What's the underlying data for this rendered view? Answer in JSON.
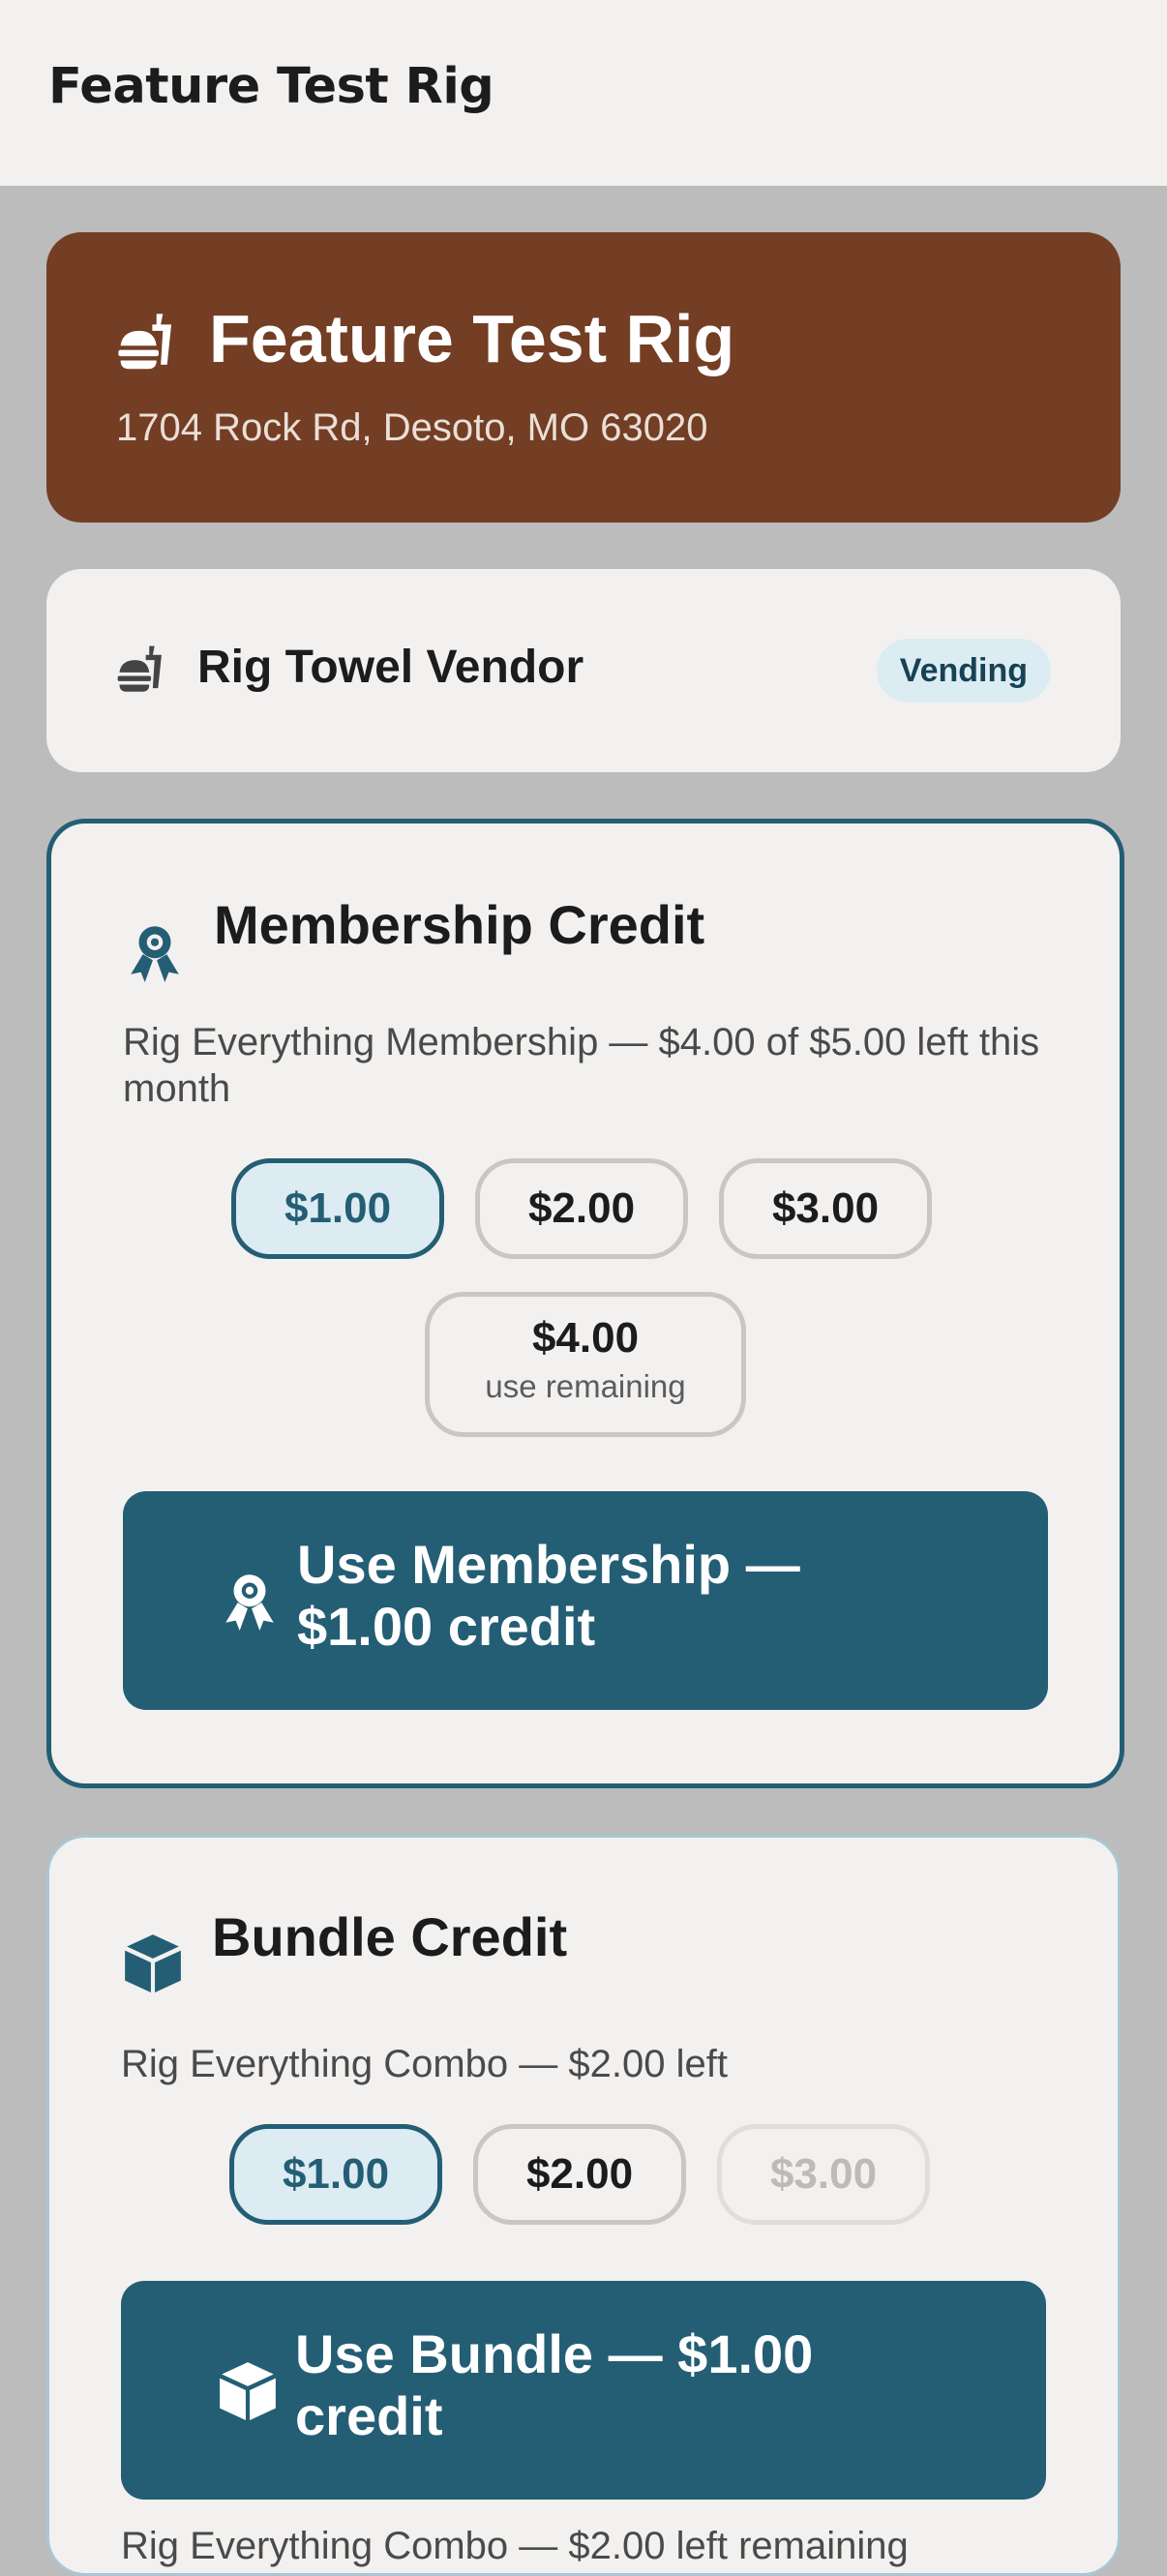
{
  "topbar": {
    "title": "Feature Test Rig"
  },
  "hero": {
    "icon": "fastfood-icon",
    "title": "Feature Test Rig",
    "address": "1704 Rock Rd, Desoto, MO 63020"
  },
  "vendor": {
    "icon": "fastfood-icon",
    "name": "Rig Towel Vendor",
    "badge": "Vending"
  },
  "membership": {
    "icon": "award-icon",
    "title": "Membership Credit",
    "description": "Rig Everything Membership — $4.00 of $5.00 left this month",
    "amounts": [
      {
        "label": "$1.00",
        "state": "selected"
      },
      {
        "label": "$2.00",
        "state": "default"
      },
      {
        "label": "$3.00",
        "state": "default"
      },
      {
        "label": "$4.00",
        "sub": "use remaining",
        "state": "default"
      }
    ],
    "button_label": "Use Membership — $1.00 credit"
  },
  "bundle": {
    "icon": "cube-icon",
    "title": "Bundle Credit",
    "description": "Rig Everything Combo — $2.00 left",
    "amounts": [
      {
        "label": "$1.00",
        "state": "selected"
      },
      {
        "label": "$2.00",
        "state": "default"
      },
      {
        "label": "$3.00",
        "state": "disabled"
      }
    ],
    "button_label": "Use Bundle — $1.00 credit",
    "footer_cut": "Rig Everything Combo — $2.00 left remaining"
  },
  "colors": {
    "hero": "#733e24",
    "accent": "#245e74",
    "page": "#bbbcbb",
    "card": "#f2f1f0"
  }
}
